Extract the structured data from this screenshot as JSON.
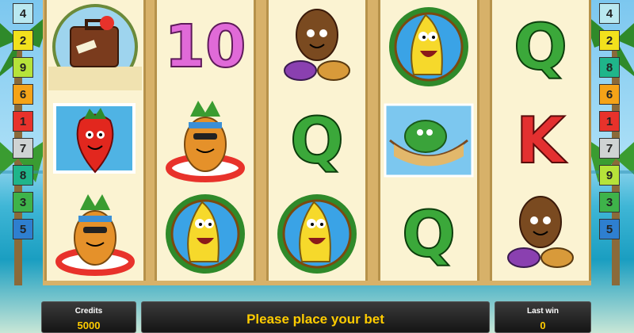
{
  "paylines": {
    "left": [
      {
        "label": "4",
        "color": "#b9e8f0"
      },
      {
        "label": "2",
        "color": "#f2e11d"
      },
      {
        "label": "9",
        "color": "#b6e33a"
      },
      {
        "label": "6",
        "color": "#f5a318"
      },
      {
        "label": "1",
        "color": "#e8322b"
      },
      {
        "label": "7",
        "color": "#cfd3d3"
      },
      {
        "label": "8",
        "color": "#1fb58a"
      },
      {
        "label": "3",
        "color": "#3eb34a"
      },
      {
        "label": "5",
        "color": "#2e7fd0"
      }
    ],
    "right": [
      {
        "label": "4",
        "color": "#b9e8f0"
      },
      {
        "label": "2",
        "color": "#f2e11d"
      },
      {
        "label": "8",
        "color": "#1fb58a"
      },
      {
        "label": "6",
        "color": "#f5a318"
      },
      {
        "label": "1",
        "color": "#e8322b"
      },
      {
        "label": "7",
        "color": "#cfd3d3"
      },
      {
        "label": "9",
        "color": "#b6e33a"
      },
      {
        "label": "3",
        "color": "#3eb34a"
      },
      {
        "label": "5",
        "color": "#2e7fd0"
      }
    ]
  },
  "reels": [
    {
      "symbols": [
        "suitcase-symbol",
        "strawberry-symbol",
        "pineapple-symbol"
      ]
    },
    {
      "symbols": [
        "ten-symbol",
        "pineapple-symbol",
        "banana-symbol"
      ]
    },
    {
      "symbols": [
        "coconut-symbol",
        "q-symbol",
        "banana-symbol"
      ]
    },
    {
      "symbols": [
        "banana-symbol",
        "melon-symbol",
        "q-symbol"
      ]
    },
    {
      "symbols": [
        "q-symbol",
        "k-symbol",
        "coconut-symbol"
      ]
    }
  ],
  "symbol_text": {
    "q": "Q",
    "k": "K",
    "ten": "10"
  },
  "footer": {
    "credits_label": "Credits",
    "credits_value": "5000",
    "message": "Please place your bet",
    "lastwin_label": "Last win",
    "lastwin_value": "0"
  }
}
